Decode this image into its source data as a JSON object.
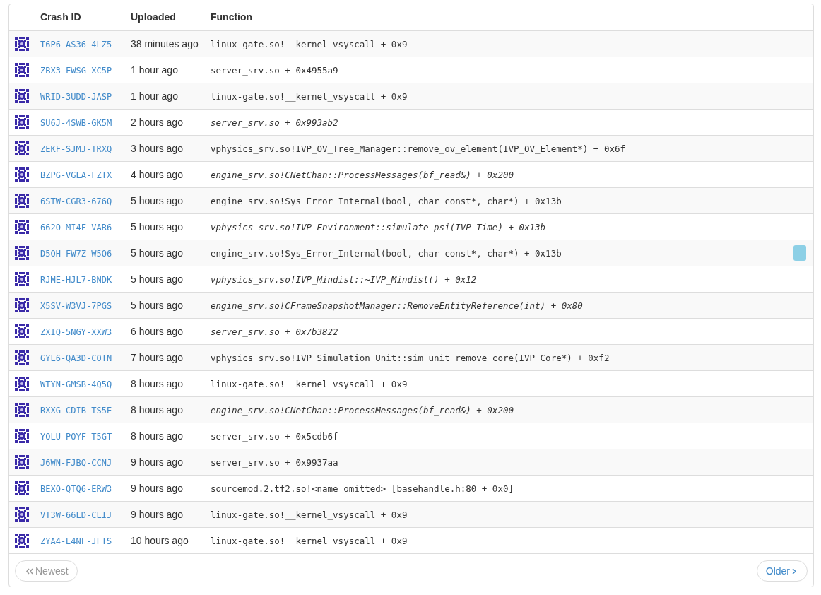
{
  "table": {
    "columns": [
      "Crash ID",
      "Uploaded",
      "Function"
    ],
    "rows": [
      {
        "crash_id": "T6P6-AS36-4LZ5",
        "uploaded": "38 minutes ago",
        "function": "linux-gate.so!__kernel_vsyscall + 0x9",
        "italic": false,
        "flagged": false
      },
      {
        "crash_id": "ZBX3-FWSG-XC5P",
        "uploaded": "1 hour ago",
        "function": "server_srv.so + 0x4955a9",
        "italic": false,
        "flagged": false
      },
      {
        "crash_id": "WRID-3UDD-JASP",
        "uploaded": "1 hour ago",
        "function": "linux-gate.so!__kernel_vsyscall + 0x9",
        "italic": false,
        "flagged": false
      },
      {
        "crash_id": "SU6J-4SWB-GK5M",
        "uploaded": "2 hours ago",
        "function": "server_srv.so + 0x993ab2",
        "italic": true,
        "flagged": false
      },
      {
        "crash_id": "ZEKF-SJMJ-TRXQ",
        "uploaded": "3 hours ago",
        "function": "vphysics_srv.so!IVP_OV_Tree_Manager::remove_ov_element(IVP_OV_Element*) + 0x6f",
        "italic": false,
        "flagged": false
      },
      {
        "crash_id": "BZPG-VGLA-FZTX",
        "uploaded": "4 hours ago",
        "function": "engine_srv.so!CNetChan::ProcessMessages(bf_read&) + 0x200",
        "italic": true,
        "flagged": false
      },
      {
        "crash_id": "6STW-CGR3-676Q",
        "uploaded": "5 hours ago",
        "function": "engine_srv.so!Sys_Error_Internal(bool, char const*, char*) + 0x13b",
        "italic": false,
        "flagged": false
      },
      {
        "crash_id": "662O-MI4F-VAR6",
        "uploaded": "5 hours ago",
        "function": "vphysics_srv.so!IVP_Environment::simulate_psi(IVP_Time) + 0x13b",
        "italic": true,
        "flagged": false
      },
      {
        "crash_id": "D5QH-FW7Z-W5O6",
        "uploaded": "5 hours ago",
        "function": "engine_srv.so!Sys_Error_Internal(bool, char const*, char*) + 0x13b",
        "italic": false,
        "flagged": true
      },
      {
        "crash_id": "RJME-HJL7-BNDK",
        "uploaded": "5 hours ago",
        "function": "vphysics_srv.so!IVP_Mindist::~IVP_Mindist() + 0x12",
        "italic": true,
        "flagged": false
      },
      {
        "crash_id": "X5SV-W3VJ-7PGS",
        "uploaded": "5 hours ago",
        "function": "engine_srv.so!CFrameSnapshotManager::RemoveEntityReference(int) + 0x80",
        "italic": true,
        "flagged": false
      },
      {
        "crash_id": "ZXIQ-5NGY-XXW3",
        "uploaded": "6 hours ago",
        "function": "server_srv.so + 0x7b3822",
        "italic": true,
        "flagged": false
      },
      {
        "crash_id": "GYL6-QA3D-COTN",
        "uploaded": "7 hours ago",
        "function": "vphysics_srv.so!IVP_Simulation_Unit::sim_unit_remove_core(IVP_Core*) + 0xf2",
        "italic": false,
        "flagged": false
      },
      {
        "crash_id": "WTYN-GMSB-4Q5Q",
        "uploaded": "8 hours ago",
        "function": "linux-gate.so!__kernel_vsyscall + 0x9",
        "italic": false,
        "flagged": false
      },
      {
        "crash_id": "RXXG-CDIB-TS5E",
        "uploaded": "8 hours ago",
        "function": "engine_srv.so!CNetChan::ProcessMessages(bf_read&) + 0x200",
        "italic": true,
        "flagged": false
      },
      {
        "crash_id": "YQLU-POYF-T5GT",
        "uploaded": "8 hours ago",
        "function": "server_srv.so + 0x5cdb6f",
        "italic": false,
        "flagged": false
      },
      {
        "crash_id": "J6WN-FJBQ-CCNJ",
        "uploaded": "9 hours ago",
        "function": "server_srv.so + 0x9937aa",
        "italic": false,
        "flagged": false
      },
      {
        "crash_id": "BEXO-QTQ6-ERW3",
        "uploaded": "9 hours ago",
        "function": "sourcemod.2.tf2.so!<name omitted> [basehandle.h:80 + 0x0]",
        "italic": false,
        "flagged": false
      },
      {
        "crash_id": "VT3W-66LD-CLIJ",
        "uploaded": "9 hours ago",
        "function": "linux-gate.so!__kernel_vsyscall + 0x9",
        "italic": false,
        "flagged": false
      },
      {
        "crash_id": "ZYA4-E4NF-JFTS",
        "uploaded": "10 hours ago",
        "function": "linux-gate.so!__kernel_vsyscall + 0x9",
        "italic": false,
        "flagged": false
      }
    ]
  },
  "pager": [
    {
      "kind": "prev",
      "label": "Newest",
      "disabled": true
    },
    {
      "kind": "next",
      "label": "Older",
      "disabled": false
    }
  ]
}
